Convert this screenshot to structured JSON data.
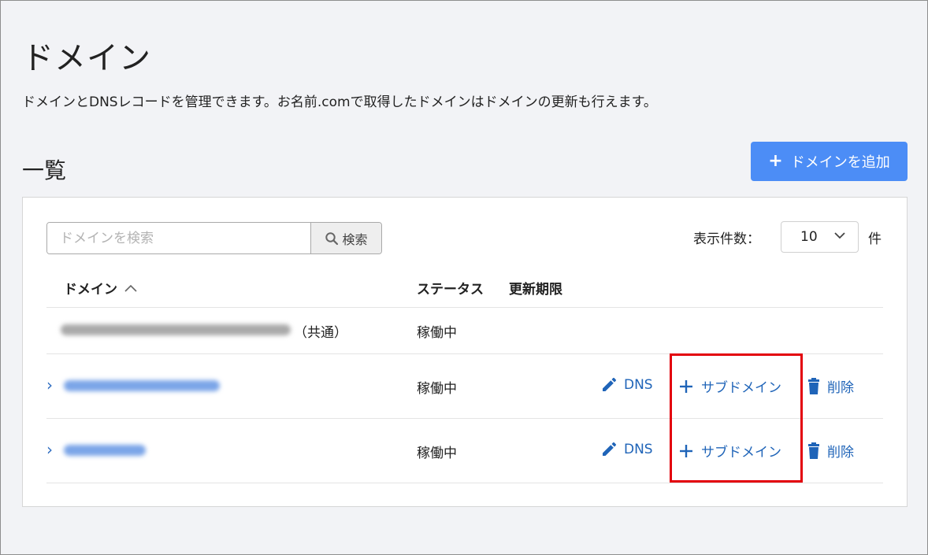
{
  "page": {
    "title": "ドメイン",
    "description": "ドメインとDNSレコードを管理できます。お名前.comで取得したドメインはドメインの更新も行えます。"
  },
  "list": {
    "title": "一覧",
    "add_button_label": "ドメインを追加",
    "search": {
      "placeholder": "ドメインを検索",
      "value": "",
      "button_label": "検索"
    },
    "per_page": {
      "label": "表示件数：",
      "value": "10",
      "unit": "件"
    },
    "columns": {
      "domain": "ドメイン",
      "status": "ステータス",
      "renewal": "更新期限"
    },
    "rows": [
      {
        "suffix": "（共通）",
        "status": "稼働中",
        "expandable": false
      },
      {
        "status": "稼働中",
        "expandable": true,
        "actions": {
          "dns": "DNS",
          "subdomain": "サブドメイン",
          "delete": "削除"
        }
      },
      {
        "status": "稼働中",
        "expandable": true,
        "actions": {
          "dns": "DNS",
          "subdomain": "サブドメイン",
          "delete": "削除"
        }
      }
    ]
  },
  "colors": {
    "primary": "#4c8df6",
    "link": "#1f64b8",
    "highlight": "#e3000b"
  }
}
